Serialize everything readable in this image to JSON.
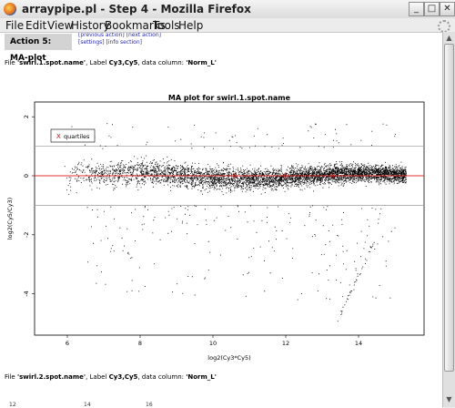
{
  "window": {
    "title": "arraypipe.pl - Step 4 - Mozilla Firefox",
    "buttons": [
      "_",
      "□",
      "✕"
    ]
  },
  "menu": [
    "File",
    "Edit",
    "View",
    "History",
    "Bookmarks",
    "Tools",
    "Help"
  ],
  "page": {
    "action_title": "Action 5: MA-plot",
    "nav_links_top": "[previous action] [next action]",
    "nav_links_bottom_a": "[settings]",
    "nav_links_bottom_b": "[info section]",
    "file1": {
      "prefix": "File ",
      "name": "'swirl.1.spot.name'",
      "mid1": ", Label ",
      "label": "Cy3,Cy5",
      "mid2": ", data column: ",
      "column": "'Norm_L'"
    },
    "file2": {
      "prefix": "File ",
      "name": "'swirl.2.spot.name'",
      "mid1": ", Label ",
      "label": "Cy3,Cy5",
      "mid2": ", data column: ",
      "column": "'Norm_L'"
    },
    "bottom_fragments": [
      "12",
      "14",
      "16"
    ]
  },
  "chart_data": {
    "type": "scatter",
    "title": "MA plot for swirl.1.spot.name",
    "xlabel": "log2(Cy3*Cy5)",
    "ylabel": "log2(Cy5/Cy3)",
    "xlim": [
      5.1,
      15.8
    ],
    "ylim": [
      -5.4,
      2.5
    ],
    "xticks": [
      6,
      8,
      10,
      12,
      14
    ],
    "yticks": [
      -4,
      -2,
      0,
      2
    ],
    "legend": {
      "label": "quartiles",
      "symbol": "X",
      "placement": "top-left"
    },
    "reference_lines": {
      "red": 0,
      "gray": [
        1.0,
        -1.0
      ]
    },
    "quartile_markers": [
      {
        "x": 10.6,
        "y": 0.0
      },
      {
        "x": 12.0,
        "y": 0.0
      },
      {
        "x": 13.3,
        "y": 0.0
      }
    ],
    "cloud": {
      "x_range": [
        5.9,
        15.3
      ],
      "center": 0.0,
      "spread": 0.42,
      "density_peak_x": 12.5
    },
    "colors": {
      "points": "#000000",
      "zero_line": "#e03030",
      "quartile_lines": "#a8a8a8",
      "quartile_marker": "#d00000"
    }
  }
}
